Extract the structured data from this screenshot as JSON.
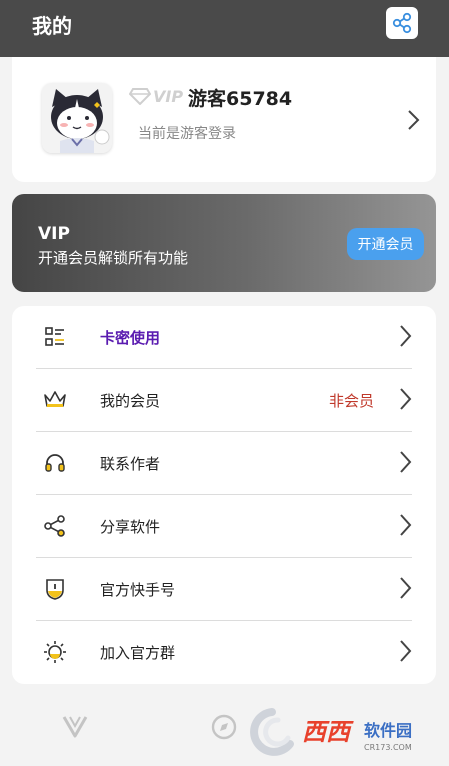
{
  "header": {
    "title": "我的"
  },
  "profile": {
    "vip_label": "VIP",
    "username": "游客65784",
    "login_status": "当前是游客登录"
  },
  "vip_card": {
    "title": "VIP",
    "description": "开通会员解锁所有功能",
    "button_label": "开通会员"
  },
  "menu": {
    "items": [
      {
        "label": "卡密使用",
        "value": "",
        "icon": "qr-card-icon"
      },
      {
        "label": "我的会员",
        "value": "非会员",
        "icon": "crown-icon"
      },
      {
        "label": "联系作者",
        "value": "",
        "icon": "headset-icon"
      },
      {
        "label": "分享软件",
        "value": "",
        "icon": "share-icon"
      },
      {
        "label": "官方快手号",
        "value": "",
        "icon": "shield-icon"
      },
      {
        "label": "加入官方群",
        "value": "",
        "icon": "sun-icon"
      }
    ]
  },
  "watermark": {
    "brand": "西西",
    "sub": "软件园",
    "domain": "CR173.COM"
  },
  "colors": {
    "topbar": "#4a4a4a",
    "accent_purple": "#5a1bb0",
    "member_red": "#c0392b",
    "button_blue": "#4aa0ee",
    "icon_yellow": "#f2c21b"
  }
}
